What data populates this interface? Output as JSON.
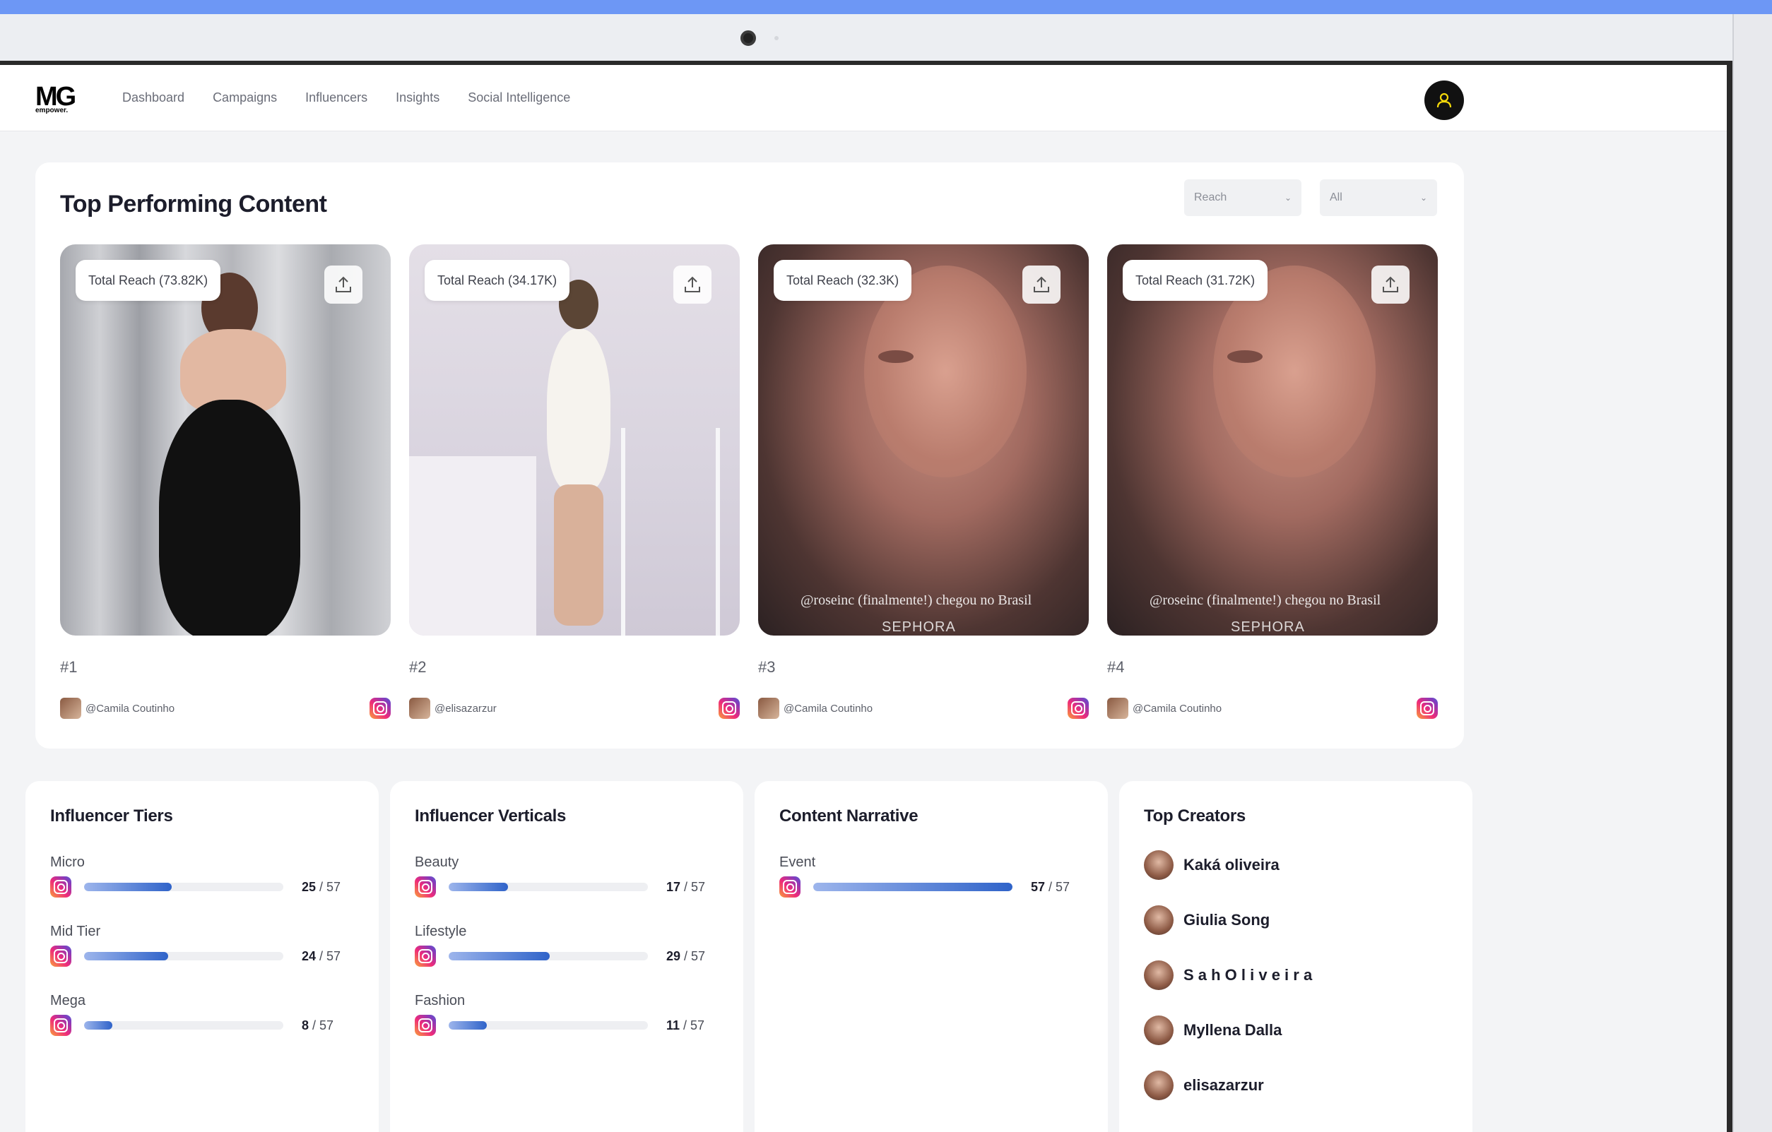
{
  "brand": {
    "logo_main": "MG",
    "logo_sub": "empower."
  },
  "nav": {
    "items": [
      {
        "label": "Dashboard"
      },
      {
        "label": "Campaigns"
      },
      {
        "label": "Influencers"
      },
      {
        "label": "Insights"
      },
      {
        "label": "Social Intelligence"
      }
    ],
    "user_icon": "user-icon"
  },
  "top_content": {
    "title": "Top Performing Content",
    "sort_select": {
      "value": "Reach"
    },
    "filter_select": {
      "value": "All"
    },
    "posts": [
      {
        "reach_label": "Total Reach (73.82K)",
        "rank": "#1",
        "author": "@Camila Coutinho",
        "platform_icon": "instagram-icon"
      },
      {
        "reach_label": "Total Reach (34.17K)",
        "rank": "#2",
        "author": "@elisazarzur",
        "platform_icon": "instagram-icon"
      },
      {
        "reach_label": "Total Reach (32.3K)",
        "rank": "#3",
        "author": "@Camila Coutinho",
        "platform_icon": "instagram-icon",
        "caption": "@roseinc (finalmente!) chegou no Brasil",
        "caption_brand": "SEPHORA"
      },
      {
        "reach_label": "Total Reach (31.72K)",
        "rank": "#4",
        "author": "@Camila Coutinho",
        "platform_icon": "instagram-icon",
        "caption": "@roseinc (finalmente!) chegou no Brasil",
        "caption_brand": "SEPHORA"
      }
    ]
  },
  "influencer_tiers": {
    "title": "Influencer Tiers",
    "items": [
      {
        "label": "Micro",
        "value": 25,
        "value_text": "25",
        "total_text": " / 57",
        "fraction": 0.4386
      },
      {
        "label": "Mid Tier",
        "value": 24,
        "value_text": "24",
        "total_text": " / 57",
        "fraction": 0.4211
      },
      {
        "label": "Mega",
        "value": 8,
        "value_text": "8",
        "total_text": " / 57",
        "fraction": 0.1404
      }
    ]
  },
  "influencer_verticals": {
    "title": "Influencer Verticals",
    "items": [
      {
        "label": "Beauty",
        "value": 17,
        "value_text": "17",
        "total_text": " / 57",
        "fraction": 0.2982
      },
      {
        "label": "Lifestyle",
        "value": 29,
        "value_text": "29",
        "total_text": " / 57",
        "fraction": 0.5088
      },
      {
        "label": "Fashion",
        "value": 11,
        "value_text": "11",
        "total_text": " / 57",
        "fraction": 0.193
      }
    ]
  },
  "content_narrative": {
    "title": "Content Narrative",
    "items": [
      {
        "label": "Event",
        "value": 57,
        "value_text": "57",
        "total_text": " / 57",
        "fraction": 1.0
      }
    ]
  },
  "top_creators": {
    "title": "Top Creators",
    "items": [
      {
        "name": "Kaká oliveira"
      },
      {
        "name": "Giulia Song"
      },
      {
        "name": "S a h O l i v e i r a"
      },
      {
        "name": "Myllena Dalla"
      },
      {
        "name": "elisazarzur"
      }
    ]
  },
  "colors": {
    "accent_bar": "#2f63c9",
    "header_blue": "#6d97f5",
    "user_icon": "#f5d90a"
  }
}
